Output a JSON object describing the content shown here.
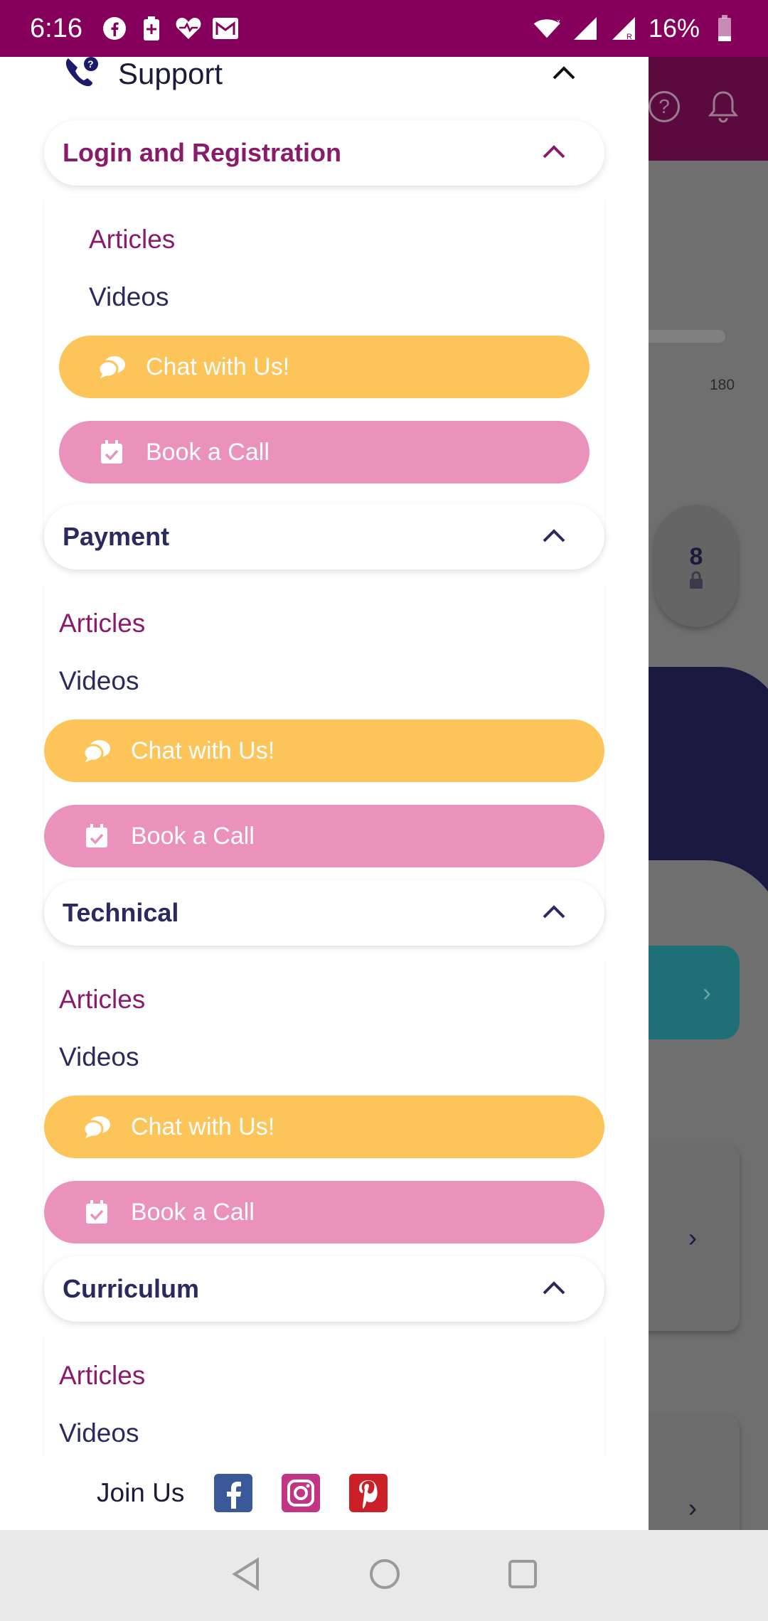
{
  "status_bar": {
    "time": "6:16",
    "battery": "16%"
  },
  "drawer": {
    "support_title": "Support",
    "sections": [
      {
        "title": "Login and Registration",
        "active": true,
        "articles": "Articles",
        "videos": "Videos",
        "chat": "Chat with Us!",
        "book": "Book a Call"
      },
      {
        "title": "Payment",
        "active": false,
        "articles": "Articles",
        "videos": "Videos",
        "chat": "Chat with Us!",
        "book": "Book a Call"
      },
      {
        "title": "Technical",
        "active": false,
        "articles": "Articles",
        "videos": "Videos",
        "chat": "Chat with Us!",
        "book": "Book a Call"
      },
      {
        "title": "Curriculum",
        "active": false,
        "articles": "Articles",
        "videos": "Videos"
      }
    ],
    "join_us": "Join Us",
    "social": [
      "facebook-icon",
      "instagram-icon",
      "pinterest-icon"
    ]
  },
  "background": {
    "level_value": "180",
    "lock_number": "8"
  },
  "colors": {
    "status_bar": "#85005a",
    "active_title": "#8a1b6b",
    "title": "#2a2a5e",
    "chat_button": "#fdc459",
    "book_button": "#eb92bc"
  }
}
